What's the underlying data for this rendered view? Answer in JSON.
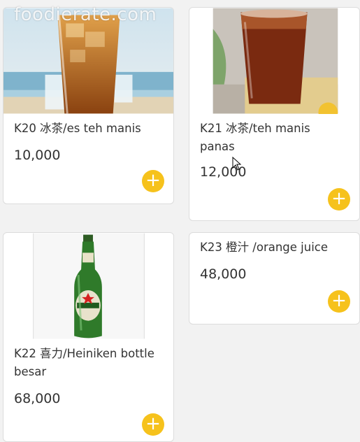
{
  "watermark": "foodierate.com",
  "items": [
    {
      "name": "K20 冰茶/es teh manis",
      "price": "10,000",
      "image": "iced-tea-beach-photo"
    },
    {
      "name": "K21 冰茶/teh manis panas",
      "price": "12,000",
      "image": "hot-tea-glass-photo"
    },
    {
      "name": "K22 喜力/Heiniken bottle besar",
      "price": "68,000",
      "image": "heineken-bottle-photo"
    },
    {
      "name": "K23 橙汁 /orange juice",
      "price": "48,000"
    }
  ],
  "add_icon": "plus-icon",
  "colors": {
    "accent": "#f6c21c",
    "background": "#f2f2f2",
    "card": "#ffffff"
  }
}
